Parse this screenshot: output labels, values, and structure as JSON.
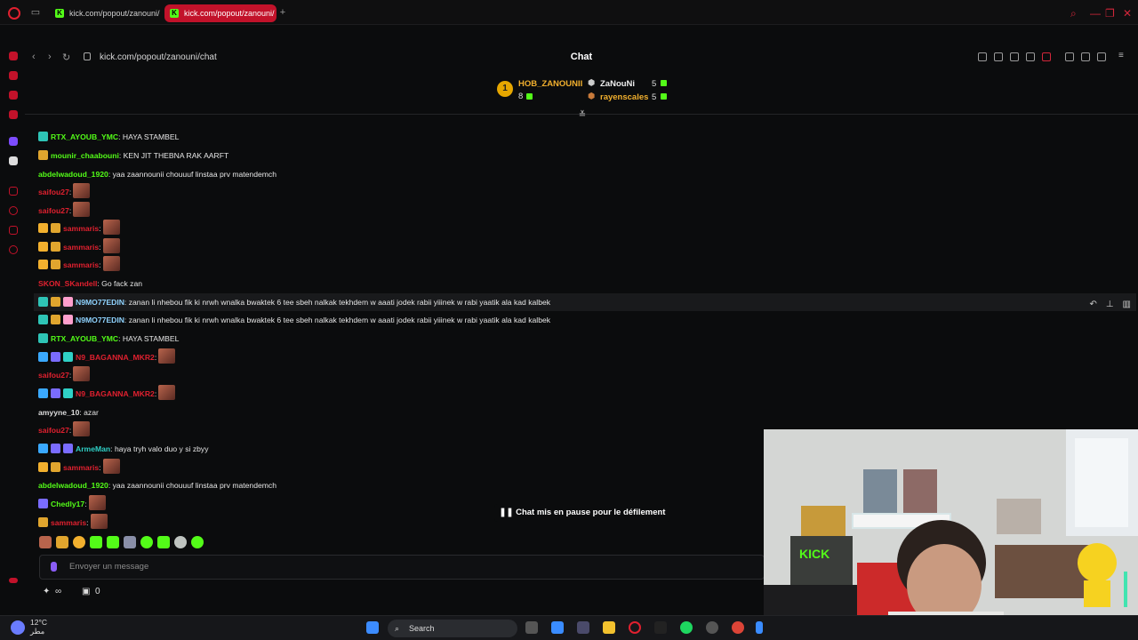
{
  "browser": {
    "tabs": [
      {
        "label": "kick.com/popout/zanouni/"
      },
      {
        "label": "kick.com/popout/zanouni/"
      }
    ],
    "url": "kick.com/popout/zanouni/chat"
  },
  "chat": {
    "title": "Chat",
    "leaderboard": {
      "first": {
        "rank": "1",
        "name": "HOB_ZANOUNII",
        "count": "8"
      },
      "second": {
        "name": "ZaNouNi",
        "count": "5"
      },
      "third": {
        "name": "rayenscales",
        "count": "5"
      }
    },
    "messages": [
      {
        "user": "RTX_AYOUB_YMC",
        "text": ": HAYA STAMBEL"
      },
      {
        "user": "mounir_chaabouni",
        "text": ": KEN JIT THEBNA RAK AARFT"
      },
      {
        "user": "abdelwadoud_1920",
        "text": ": yaa zaannounii chouuuf linstaa prv matendemch"
      },
      {
        "user": "saifou27",
        "text": ":"
      },
      {
        "user": "saifou27",
        "text": ":"
      },
      {
        "user": "sammaris",
        "text": ":"
      },
      {
        "user": "sammaris",
        "text": ":"
      },
      {
        "user": "sammaris",
        "text": ":"
      },
      {
        "user": "SKON_SKandell",
        "text": ": Go fack zan"
      },
      {
        "user": "N9MO77EDIN",
        "text": ": zanan li nhebou fik ki nrwh wnalka bwaktek 6 tee sbeh nalkak tekhdem w aaati jodek rabii yiiinek w rabi yaatik ala kad kalbek"
      },
      {
        "user": "N9MO77EDIN",
        "text": ": zanan li nhebou fik ki nrwh wnalka bwaktek 6 tee sbeh nalkak tekhdem w aaati jodek rabii yiiinek w rabi yaatik ala kad kalbek"
      },
      {
        "user": "RTX_AYOUB_YMC",
        "text": ": HAYA STAMBEL"
      },
      {
        "user": "N9_BAGANNA_MKR2",
        "text": ":"
      },
      {
        "user": "saifou27",
        "text": ":"
      },
      {
        "user": "N9_BAGANNA_MKR2",
        "text": ":"
      },
      {
        "user": "amyyne_10",
        "text": ": azar"
      },
      {
        "user": "saifou27",
        "text": ":"
      },
      {
        "user": "ArmeMan",
        "text": ": haya tryh valo duo y si zbyy"
      },
      {
        "user": "sammaris",
        "text": ":"
      },
      {
        "user": "abdelwadoud_1920",
        "text": ": yaa zaannounii chouuuf linstaa prv matendemch"
      },
      {
        "user": "Chedly17",
        "text": ":"
      },
      {
        "user": "sammaris",
        "text": ":"
      }
    ],
    "pause_banner": "Chat mis en pause pour le défilement",
    "input_placeholder": "Envoyer un message",
    "footer": {
      "infinity": "∞",
      "points": "0"
    }
  },
  "taskbar": {
    "weather_temp": "12°C",
    "weather_desc": "مطر",
    "search_label": "Search"
  },
  "colors": {
    "kick_green": "#53fc18",
    "opera_red": "#e0202f",
    "active_tab": "#c2122a"
  }
}
